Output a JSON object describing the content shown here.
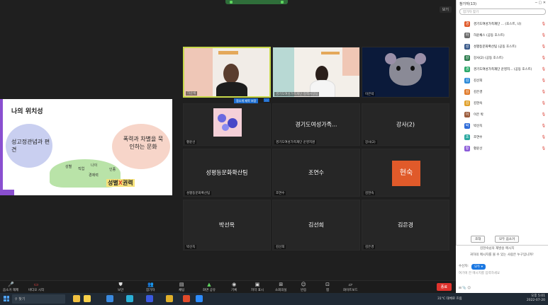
{
  "zoom": {
    "view_button": "보기",
    "tiles": [
      {
        "name": "하윤채",
        "type": "video",
        "active": true
      },
      {
        "name": "경기도여성가족재단 정책사업팀",
        "type": "video"
      },
      {
        "name": "이은박",
        "type": "video"
      },
      {
        "name": "황윤선",
        "type": "image"
      },
      {
        "name": "경기도여성가족재단 운영지원",
        "display": "경기도여성가족..."
      },
      {
        "name": "강사(2)",
        "display": "강사(2)"
      },
      {
        "name": "성평등문화확산팀",
        "display": "성평등문화확산팀"
      },
      {
        "name": "조연수",
        "display": "조연수"
      },
      {
        "name": "김현숙",
        "display": "현숙"
      },
      {
        "name": "박선옥",
        "display": "박선옥"
      },
      {
        "name": "김선희",
        "display": "김선희"
      },
      {
        "name": "김은경",
        "display": "김은경"
      }
    ],
    "sharing_badge": "정소개 제목 보장",
    "slide": {
      "title": "나의 위치성",
      "left_blob": "성고정관념과 편견",
      "right_blob": "폭력과 차별을 묵인하는 문화",
      "words": [
        "성별",
        "직업",
        "나이",
        "경제력",
        "인종"
      ],
      "key_prefix": "성별",
      "key_x": "X",
      "key_suffix": "권력"
    },
    "toolbar": {
      "items": [
        "음소거 해제",
        "비디오 시작",
        "보안",
        "참가자",
        "채팅",
        "화면 공유",
        "기록",
        "자막 표시",
        "소회의실",
        "반응",
        "앱",
        "화이트보드"
      ],
      "participants_count": "12",
      "end_button": "종료"
    }
  },
  "participants_panel": {
    "title": "참가자(13)",
    "search_placeholder": "참가자 찾기",
    "list": [
      {
        "initial": "경",
        "name": "경기도여성가족재단 ... (호스트, 나)",
        "color": "#e05a2a"
      },
      {
        "initial": "하",
        "name": "하윤채스 (공동 호스트)",
        "color": "#6a6a6a"
      },
      {
        "initial": "성",
        "name": "성평등문화확산팀 (공동 호스트)",
        "color": "#3a5a8a"
      },
      {
        "initial": "강",
        "name": "강사(2) (공동 호스트)",
        "color": "#2e7d4f"
      },
      {
        "initial": "경",
        "name": "경기도여성가족재단 운영지... (공동 호스트)",
        "color": "#2aa86a"
      },
      {
        "initial": "김",
        "name": "김선희",
        "color": "#2c8ad8"
      },
      {
        "initial": "김",
        "name": "김은경",
        "color": "#e07a2a"
      },
      {
        "initial": "김",
        "name": "김현숙",
        "color": "#e0a02a"
      },
      {
        "initial": "이",
        "name": "이은 박",
        "color": "#9a5a3a"
      },
      {
        "initial": "박",
        "name": "박선옥",
        "color": "#2c6ad8"
      },
      {
        "initial": "조",
        "name": "조연수",
        "color": "#2aa8a0"
      },
      {
        "initial": "황",
        "name": "황윤선",
        "color": "#8a5ad8"
      }
    ],
    "invite_button": "초대",
    "mute_all_button": "모두 음소거"
  },
  "chat": {
    "line1": "김현숙님의 재발송 메시지",
    "line2": "귀하의 메시지를 볼 수 있는 사람은 누구입니까?",
    "to_label": "수신자:",
    "to_value": "모두 ▾",
    "placeholder": "여기에 한 메시지를 입력하세요"
  },
  "taskbar": {
    "search_placeholder": "찾기",
    "weather": "31°C 대체로 흐림",
    "time": "오후 5:01",
    "date": "2022-07-20"
  }
}
